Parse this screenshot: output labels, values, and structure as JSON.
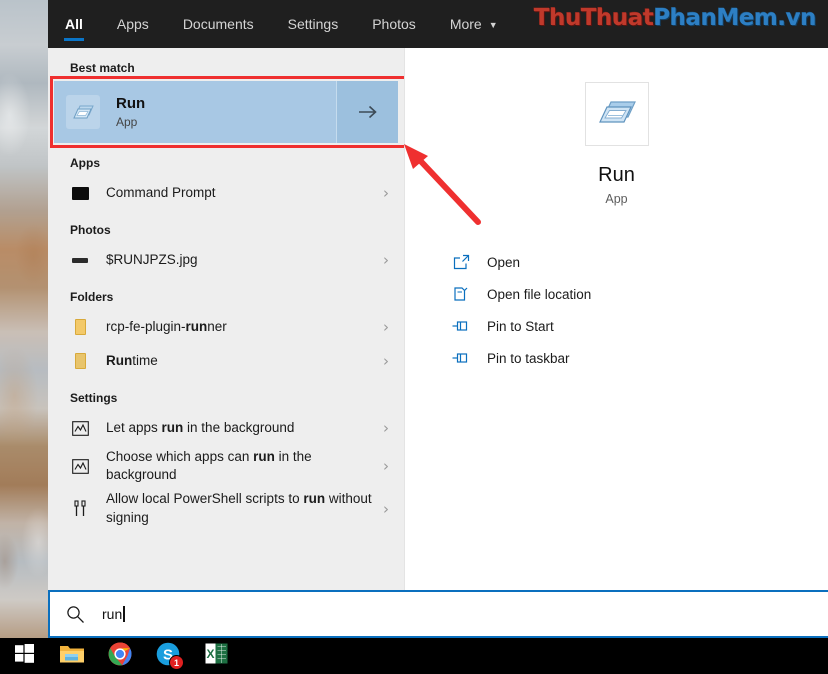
{
  "header": {
    "tabs": [
      {
        "label": "All",
        "active": true
      },
      {
        "label": "Apps",
        "active": false
      },
      {
        "label": "Documents",
        "active": false
      },
      {
        "label": "Settings",
        "active": false
      },
      {
        "label": "Photos",
        "active": false
      },
      {
        "label": "More",
        "active": false,
        "chevron": "▼"
      }
    ],
    "watermark": {
      "part1": "ThuThuat",
      "part2": "PhanMem",
      "part3": ".vn"
    }
  },
  "results": {
    "best_match_heading": "Best match",
    "best_match": {
      "title": "Run",
      "subtitle": "App",
      "icon": "run-app-icon",
      "arrow": "→"
    },
    "sections": [
      {
        "heading": "Apps",
        "items": [
          {
            "label": "Command Prompt",
            "icon": "command-prompt-icon",
            "chevron": "›"
          }
        ]
      },
      {
        "heading": "Photos",
        "items": [
          {
            "label": "$RUNJPZS.jpg",
            "icon": "photo-icon",
            "chevron": "›"
          }
        ]
      },
      {
        "heading": "Folders",
        "items": [
          {
            "label_pre": "rcp-fe-plugin-",
            "label_bold": "run",
            "label_post": "ner",
            "icon": "folder-icon",
            "chevron": "›"
          },
          {
            "label_pre": "",
            "label_bold": "Run",
            "label_post": "time",
            "icon": "folder-icon",
            "chevron": "›"
          }
        ]
      },
      {
        "heading": "Settings",
        "items": [
          {
            "label_pre": "Let apps ",
            "label_bold": "run",
            "label_post": " in the background",
            "icon": "background-apps-icon",
            "chevron": "›"
          },
          {
            "label_pre": "Choose which apps can ",
            "label_bold": "run",
            "label_post": " in the background",
            "icon": "background-apps-icon",
            "chevron": "›"
          },
          {
            "label_pre": "Allow local PowerShell scripts to ",
            "label_bold": "run",
            "label_post": " without signing",
            "icon": "powershell-scripts-icon",
            "chevron": "›"
          }
        ]
      }
    ]
  },
  "preview": {
    "icon": "run-app-icon",
    "title": "Run",
    "subtitle": "App",
    "actions": [
      {
        "label": "Open",
        "icon": "open-icon"
      },
      {
        "label": "Open file location",
        "icon": "open-file-location-icon"
      },
      {
        "label": "Pin to Start",
        "icon": "pin-icon"
      },
      {
        "label": "Pin to taskbar",
        "icon": "pin-icon"
      }
    ]
  },
  "search": {
    "value": "run",
    "icon": "search-icon"
  },
  "taskbar": {
    "items": [
      {
        "name": "start-button",
        "icon": "windows-logo-icon"
      },
      {
        "name": "file-explorer-button",
        "icon": "file-explorer-icon"
      },
      {
        "name": "chrome-button",
        "icon": "chrome-icon"
      },
      {
        "name": "skype-button",
        "icon": "skype-icon",
        "badge": "1"
      },
      {
        "name": "excel-button",
        "icon": "excel-icon"
      }
    ]
  },
  "annotations": {
    "highlight_color": "#ef2f2f",
    "arrow_color": "#ef3030"
  }
}
